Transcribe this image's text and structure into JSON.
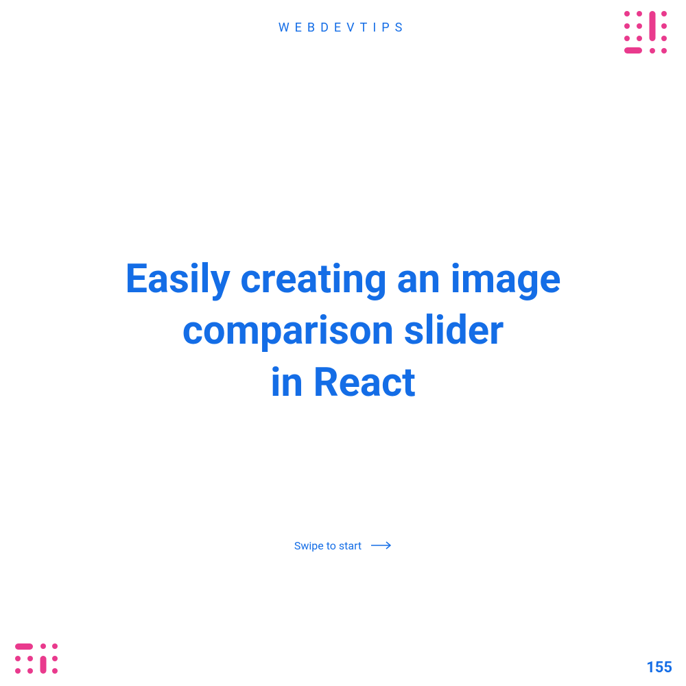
{
  "header": {
    "brand": "WEBDEVTIPS"
  },
  "main": {
    "title": "Easily creating an image\ncomparison slider\nin React"
  },
  "cta": {
    "label": "Swipe to start"
  },
  "footer": {
    "page_number": "155"
  },
  "colors": {
    "primary": "#146DE6",
    "accent": "#E93A8D"
  }
}
